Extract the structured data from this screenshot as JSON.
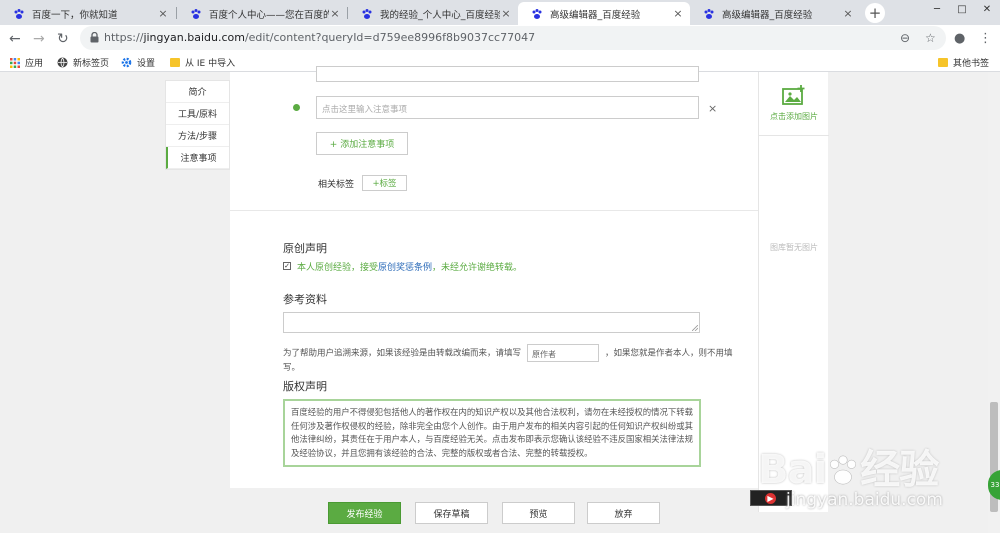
{
  "browser": {
    "tabs": [
      {
        "title": "百度一下，你就知道",
        "active": false
      },
      {
        "title": "百度个人中心——您在百度的家",
        "active": false
      },
      {
        "title": "我的经验_个人中心_百度经验",
        "active": false
      },
      {
        "title": "高级编辑器_百度经验",
        "active": true
      },
      {
        "title": "高级编辑器_百度经验",
        "active": false
      }
    ],
    "tab_close": "×",
    "new_tab": "+",
    "window": {
      "minimize": "─",
      "maximize": "□",
      "close": "✕"
    },
    "address": {
      "scheme": "https://",
      "host": "jingyan.baidu.com",
      "path": "/edit/content?queryId=d759ee8996f8b9037cc77047"
    },
    "nav": {
      "back": "←",
      "forward": "→",
      "reload": "↻",
      "zoom": "⊖",
      "star": "☆",
      "account": "●",
      "menu": "⋮"
    },
    "bookmarks": [
      {
        "label": "应用",
        "icon": "apps-icon"
      },
      {
        "label": "新标签页",
        "icon": "globe-icon"
      },
      {
        "label": "设置",
        "icon": "gear-icon"
      },
      {
        "label": "从 IE 中导入",
        "icon": "folder-icon"
      }
    ],
    "other_bookmarks": "其他书签"
  },
  "sidenav": {
    "items": [
      {
        "label": "简介",
        "active": false
      },
      {
        "label": "工具/原料",
        "active": false
      },
      {
        "label": "方法/步骤",
        "active": false
      },
      {
        "label": "注意事项",
        "active": true
      }
    ]
  },
  "editor": {
    "notes_placeholder": "点击这里输入注意事项",
    "remove": "×",
    "add_note_button": "+ 添加注意事项",
    "tags_label": "相关标签",
    "add_tag_button": "+标签",
    "original_title": "原创声明",
    "original_check": "✓",
    "original_text_prefix": "本人原创经验，接受",
    "original_link": "原创奖惩条例",
    "original_text_suffix": "，未经允许谢绝转载。",
    "reference_title": "参考资料",
    "reference_note_prefix": "为了帮助用户追溯来源，如果该经验是由转载改编而来，请填写",
    "author_placeholder": "原作者",
    "reference_note_suffix": "，如果您就是作者本人，则不用填写。",
    "copyright_title": "版权声明",
    "copyright_text": "百度经验的用户不得侵犯包括他人的著作权在内的知识产权以及其他合法权利，请勿在未经授权的情况下转载任何涉及著作权侵权的经验，除非完全由您个人创作。由于用户发布的相关内容引起的任何知识产权纠纷或其他法律纠纷，其责任在于用户本人，与百度经验无关。点击发布即表示您确认该经验不违反国家相关法律法规及经验协议，并且您拥有该经验的合法、完整的版权或者合法、完整的转载授权。"
  },
  "right_panel": {
    "add_image": "点击添加图片",
    "empty": "图库暂无图片"
  },
  "actions": {
    "publish": "发布经验",
    "save_draft": "保存草稿",
    "preview": "预览",
    "discard": "放弃"
  },
  "watermark": {
    "brand": "Bai",
    "brand_cn": "经验",
    "url": "jingyan.baidu.com"
  },
  "badge": "33",
  "colors": {
    "accent": "#5bab42",
    "link": "#2a6ab8",
    "tabbar": "#dee1e6",
    "page_bg": "#f0f0f0"
  }
}
